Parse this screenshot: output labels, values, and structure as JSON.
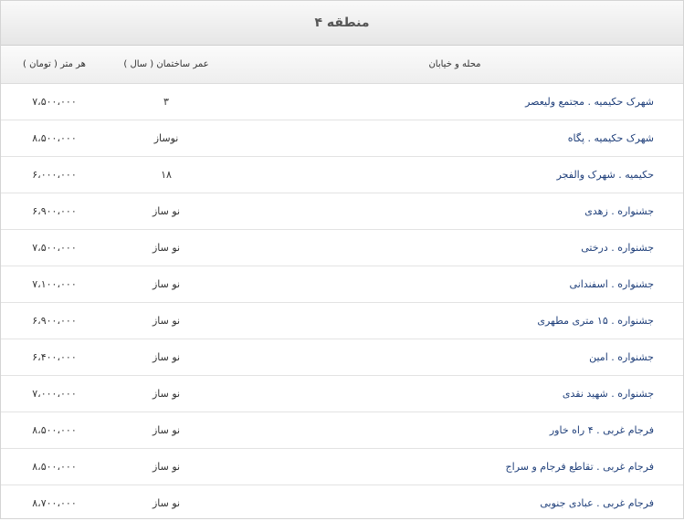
{
  "title": "منطقه ۴",
  "headers": {
    "street": "محله و خیابان",
    "age": "عمر ساختمان ( سال )",
    "price": "هر متر ( تومان )"
  },
  "rows": [
    {
      "street": "شهرک حکیمیه . مجتمع ولیعصر",
      "age": "۳",
      "price": "۷،۵۰۰،۰۰۰"
    },
    {
      "street": "شهرک حکیمیه . پگاه",
      "age": "نوساز",
      "price": "۸،۵۰۰،۰۰۰"
    },
    {
      "street": "حکیمیه . شهرک والفجر",
      "age": "۱۸",
      "price": "۶،۰۰۰،۰۰۰"
    },
    {
      "street": "جشنواره . زهدی",
      "age": "نو ساز",
      "price": "۶،۹۰۰،۰۰۰"
    },
    {
      "street": "جشنواره . درختی",
      "age": "نو ساز",
      "price": "۷،۵۰۰،۰۰۰"
    },
    {
      "street": "جشنواره . اسفندانی",
      "age": "نو ساز",
      "price": "۷،۱۰۰،۰۰۰"
    },
    {
      "street": "جشنواره . ۱۵ متری مطهری",
      "age": "نو ساز",
      "price": "۶،۹۰۰،۰۰۰"
    },
    {
      "street": "جشنواره . امین",
      "age": "نو ساز",
      "price": "۶،۴۰۰،۰۰۰"
    },
    {
      "street": "جشنواره . شهید نقدی",
      "age": "نو ساز",
      "price": "۷،۰۰۰،۰۰۰"
    },
    {
      "street": "فرجام غربی . ۴ راه خاور",
      "age": "نو ساز",
      "price": "۸،۵۰۰،۰۰۰"
    },
    {
      "street": "فرجام غربی . تقاطع فرجام و سراج",
      "age": "نو ساز",
      "price": "۸،۵۰۰،۰۰۰"
    },
    {
      "street": "فرجام غربی . عبادی جنوبی",
      "age": "نو ساز",
      "price": "۸،۷۰۰،۰۰۰"
    }
  ]
}
